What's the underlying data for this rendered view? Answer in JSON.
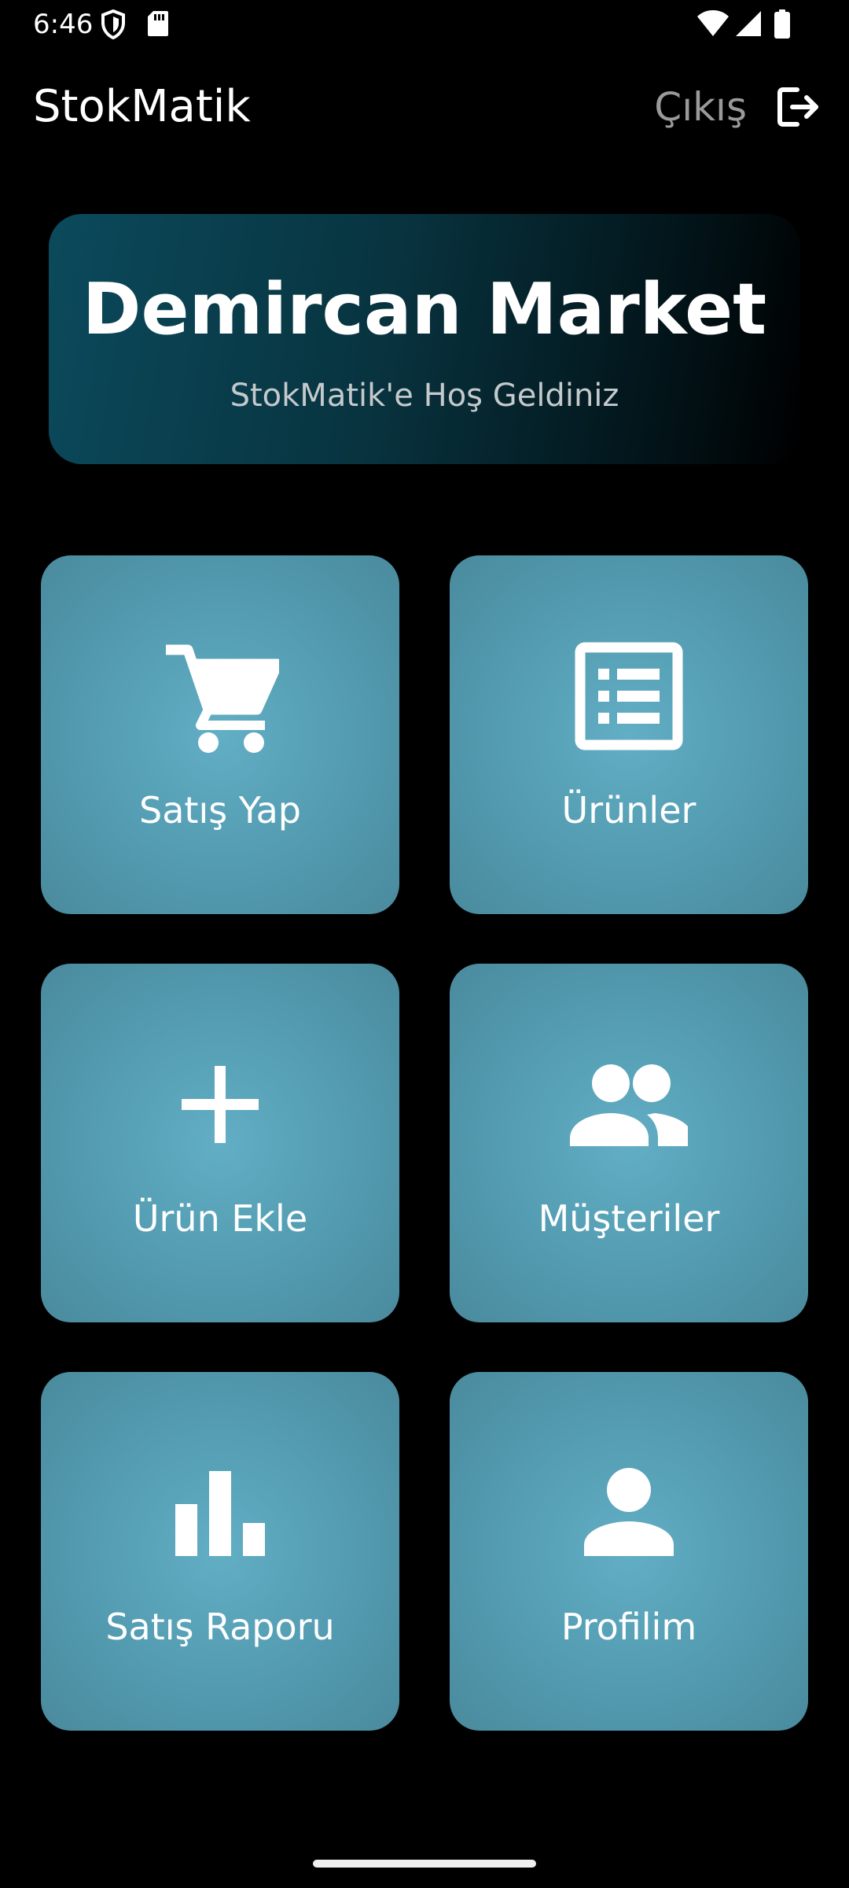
{
  "status_bar": {
    "time": "6:46",
    "left_icons": [
      "shield-icon",
      "sd-card-icon"
    ],
    "right_icons": [
      "wifi-icon",
      "signal-icon",
      "battery-icon"
    ]
  },
  "app_bar": {
    "title": "StokMatik",
    "logout_label": "Çıkış",
    "logout_icon": "logout-icon"
  },
  "banner": {
    "title": "Demircan Market",
    "subtitle": "StokMatik'e Hoş Geldiniz"
  },
  "menu": [
    {
      "label": "Satış Yap",
      "icon": "cart-icon"
    },
    {
      "label": "Ürünler",
      "icon": "list-icon"
    },
    {
      "label": "Ürün Ekle",
      "icon": "plus-icon"
    },
    {
      "label": "Müşteriler",
      "icon": "people-icon"
    },
    {
      "label": "Satış Raporu",
      "icon": "bar-chart-icon"
    },
    {
      "label": "Profilim",
      "icon": "person-icon"
    }
  ],
  "colors": {
    "background": "#000000",
    "tile": "#559eb4",
    "banner_start": "#0b4a5c",
    "muted_text": "#9a9a9a"
  }
}
